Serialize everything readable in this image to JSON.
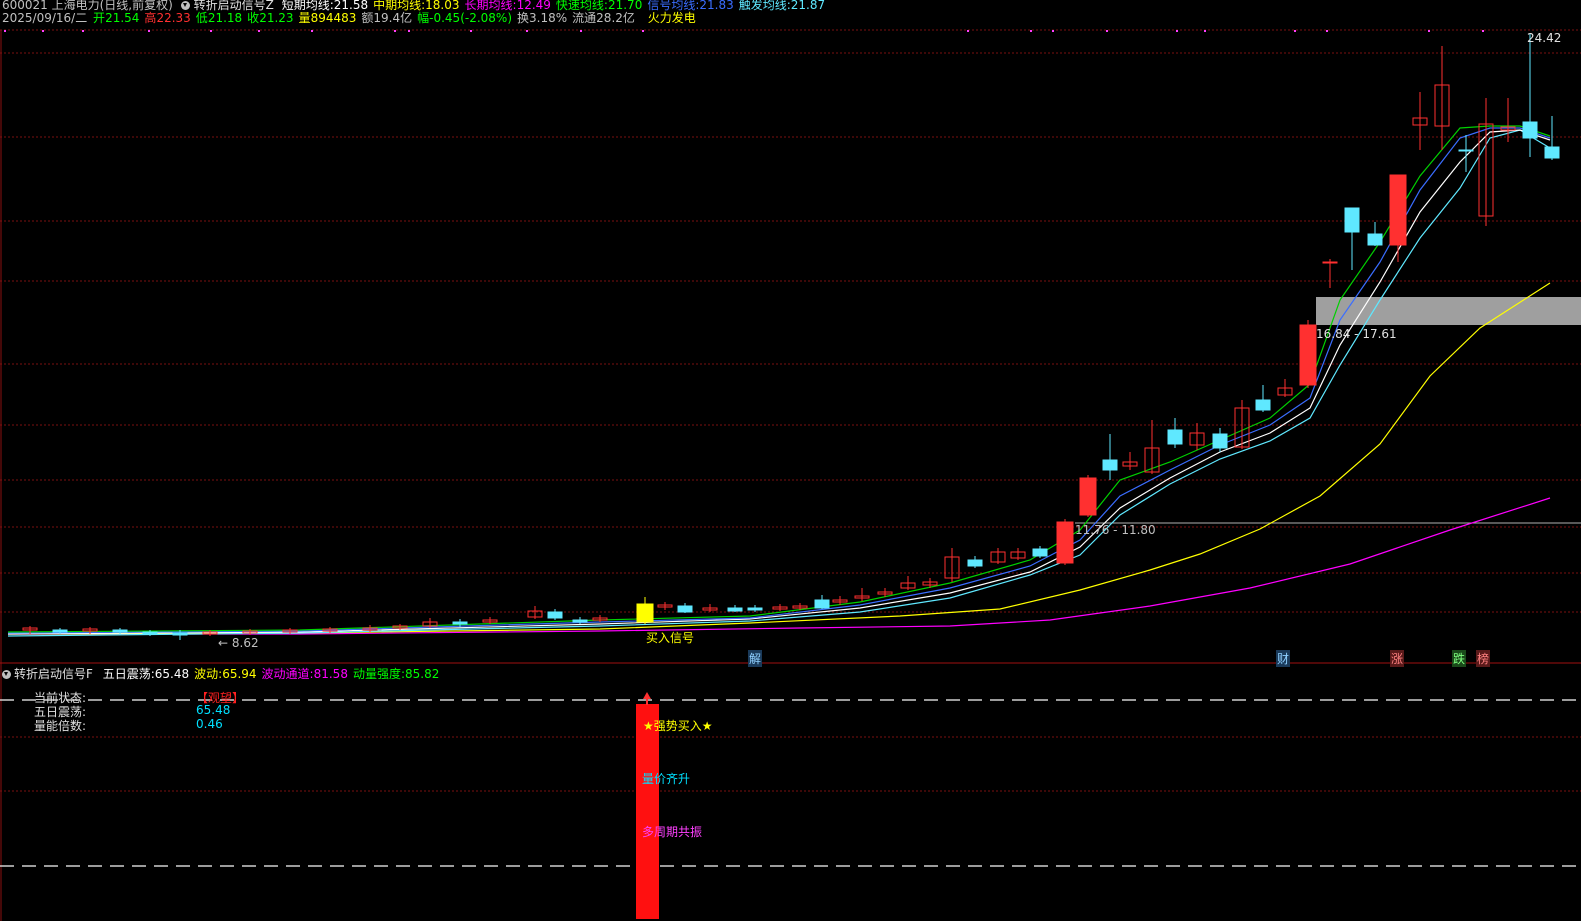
{
  "header": {
    "stock_title": "600021 上海电力(日线,前复权)",
    "indicator_name": "转折启动信号Z",
    "ma_items": [
      {
        "label": "短期均线:",
        "value": "21.58",
        "color": "#ffffff"
      },
      {
        "label": "中期均线:",
        "value": "18.03",
        "color": "#ffff00"
      },
      {
        "label": "长期均线:",
        "value": "12.49",
        "color": "#ff00ff"
      },
      {
        "label": "快速均线:",
        "value": "21.70",
        "color": "#00ff00"
      },
      {
        "label": "信号均线:",
        "value": "21.83",
        "color": "#3a6dff"
      },
      {
        "label": "触发均线:",
        "value": "21.87",
        "color": "#5fe8ff"
      }
    ],
    "date": "2025/09/16/二",
    "quote": [
      {
        "label": "开",
        "value": "21.54",
        "color": "#00ff00"
      },
      {
        "label": "高",
        "value": "22.33",
        "color": "#ff3030"
      },
      {
        "label": "低",
        "value": "21.18",
        "color": "#00ff00"
      },
      {
        "label": "收",
        "value": "21.23",
        "color": "#00ff00"
      },
      {
        "label": "量",
        "value": "894483",
        "color": "#ffff00"
      },
      {
        "label": "额",
        "value": "19.4亿",
        "color": "#c0c0c0"
      },
      {
        "label": "幅",
        "value": "-0.45(-2.08%)",
        "color": "#00ff00"
      },
      {
        "label": "换",
        "value": "3.18%",
        "color": "#c0c0c0"
      },
      {
        "label": "流通",
        "value": "28.2亿",
        "color": "#c0c0c0"
      }
    ],
    "concept": "火力发电"
  },
  "price_chart": {
    "max_label": "24.42",
    "min_label": "8.62",
    "buy_signal_label": "买入信号",
    "zone_upper_label": "16.84 - 17.61",
    "zone_lower_label": "11.76 - 11.80",
    "event_markers": [
      {
        "text": "解",
        "bg": "#1a3a5a",
        "color": "#8fd0ff"
      },
      {
        "text": "财",
        "bg": "#1a3a5a",
        "color": "#8fd0ff"
      },
      {
        "text": "涨",
        "bg": "#5a1a1a",
        "color": "#ff8080"
      },
      {
        "text": "跌",
        "bg": "#1a4a1a",
        "color": "#80ff80"
      },
      {
        "text": "榜",
        "bg": "#5a1a1a",
        "color": "#ff8080"
      }
    ]
  },
  "indicator_panel": {
    "name": "转折启动信号F",
    "items": [
      {
        "label": "五日震荡:",
        "value": "65.48",
        "color": "#ffffff"
      },
      {
        "label": "波动:",
        "value": "65.94",
        "color": "#ffff00"
      },
      {
        "label": "波动通道:",
        "value": "81.58",
        "color": "#ff00ff"
      },
      {
        "label": "动量强度:",
        "value": "85.82",
        "color": "#00ff00"
      }
    ],
    "state_label": "当前状态:",
    "state_value": "【观望】",
    "wuri_label": "五日震荡:",
    "wuri_value": "65.48",
    "liang_label": "量能倍数:",
    "liang_value": "0.46",
    "signal_strong_buy": "★强势买入★",
    "signal_volume_price": "量价齐升",
    "signal_multi_cycle": "多周期共振"
  }
}
